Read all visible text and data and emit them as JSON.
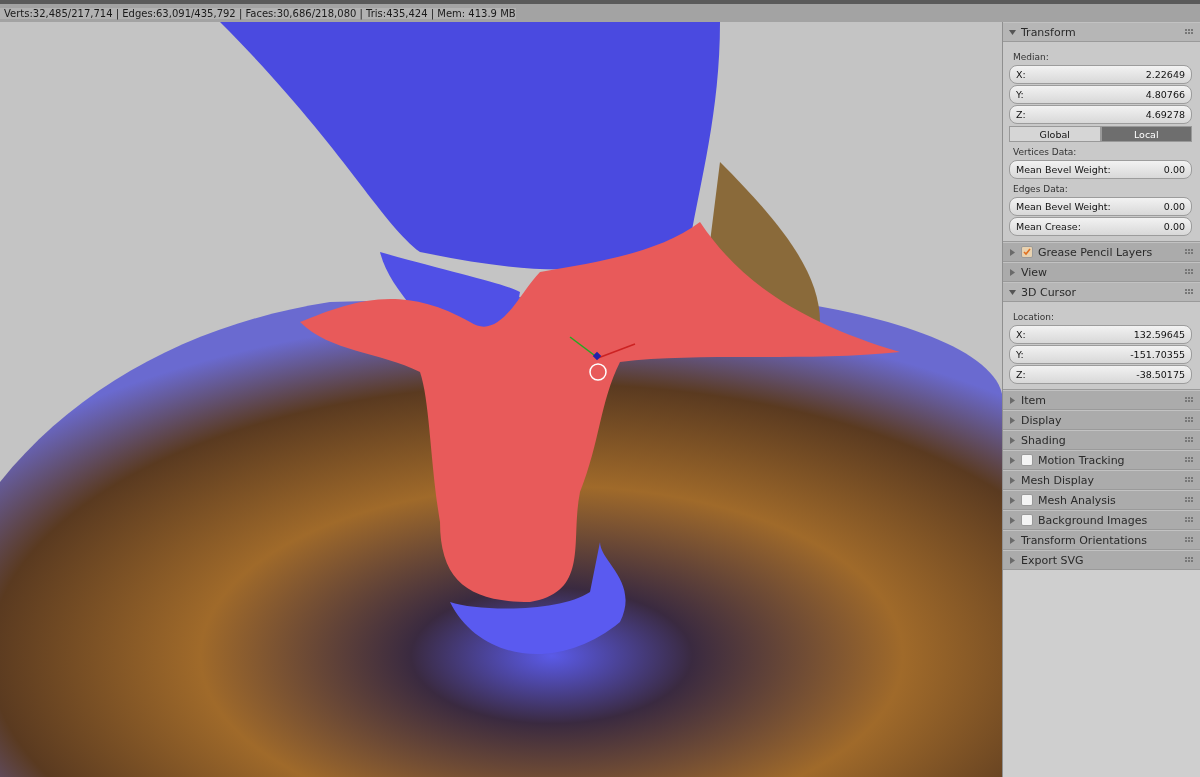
{
  "status_bar": {
    "text": "Verts:32,485/217,714 | Edges:63,091/435,792 | Faces:30,686/218,080 | Tris:435,424 | Mem: 413.9 MB"
  },
  "panels": [
    {
      "title": "Transform",
      "expanded": true,
      "rows": [
        {
          "kind": "label",
          "text": "Median:"
        },
        {
          "kind": "field",
          "label": "X:",
          "value": "2.22649"
        },
        {
          "kind": "field",
          "label": "Y:",
          "value": "4.80766"
        },
        {
          "kind": "field",
          "label": "Z:",
          "value": "4.69278"
        },
        {
          "kind": "toggle",
          "options": [
            {
              "label": "Global",
              "selected": false
            },
            {
              "label": "Local",
              "selected": true
            }
          ]
        },
        {
          "kind": "label",
          "text": "Vertices Data:"
        },
        {
          "kind": "field",
          "label": "Mean Bevel Weight:",
          "value": "0.00"
        },
        {
          "kind": "label",
          "text": "Edges Data:"
        },
        {
          "kind": "field",
          "label": "Mean Bevel Weight:",
          "value": "0.00"
        },
        {
          "kind": "field",
          "label": "Mean Crease:",
          "value": "0.00"
        }
      ]
    },
    {
      "title": "Grease Pencil Layers",
      "expanded": false,
      "checked": true
    },
    {
      "title": "View",
      "expanded": false
    },
    {
      "title": "3D Cursor",
      "expanded": true,
      "rows": [
        {
          "kind": "label",
          "text": "Location:"
        },
        {
          "kind": "field",
          "label": "X:",
          "value": "132.59645"
        },
        {
          "kind": "field",
          "label": "Y:",
          "value": "-151.70355"
        },
        {
          "kind": "field",
          "label": "Z:",
          "value": "-38.50175"
        }
      ]
    },
    {
      "title": "Item",
      "expanded": false
    },
    {
      "title": "Display",
      "expanded": false
    },
    {
      "title": "Shading",
      "expanded": false
    },
    {
      "title": "Motion Tracking",
      "expanded": false,
      "checked": false
    },
    {
      "title": "Mesh Display",
      "expanded": false
    },
    {
      "title": "Mesh Analysis",
      "expanded": false,
      "checked": false
    },
    {
      "title": "Background Images",
      "expanded": false,
      "checked": false
    },
    {
      "title": "Transform Orientations",
      "expanded": false
    },
    {
      "title": "Export SVG",
      "expanded": false
    }
  ]
}
